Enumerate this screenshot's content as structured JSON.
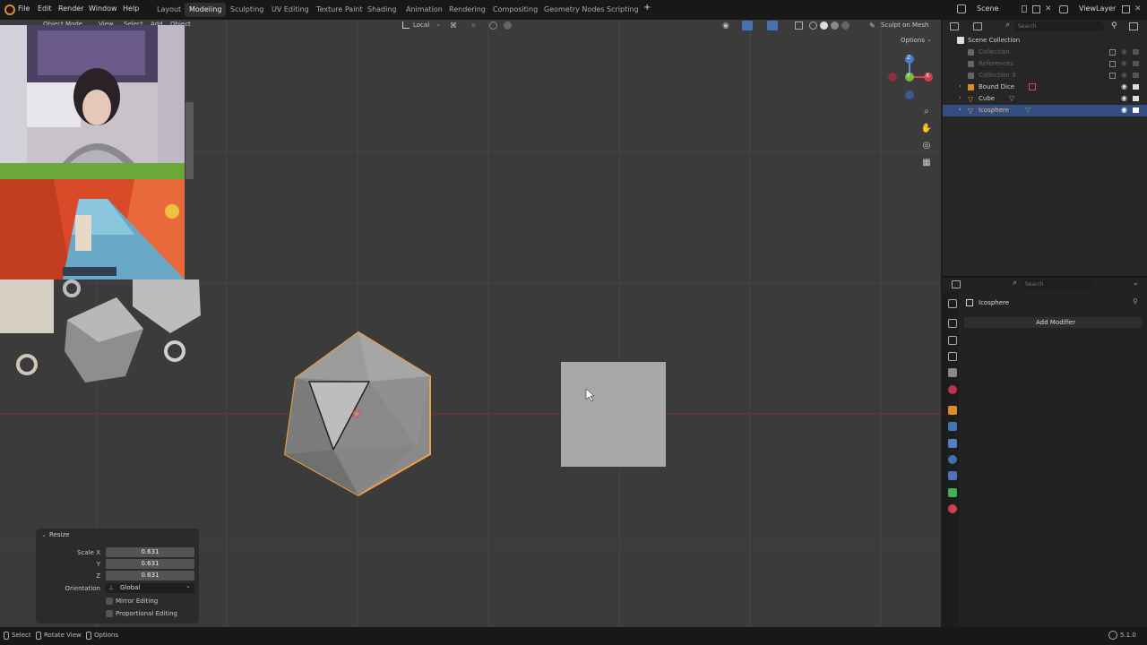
{
  "topbar": {
    "menus": [
      "File",
      "Edit",
      "Render",
      "Window",
      "Help"
    ],
    "workspaces": [
      "Layout",
      "Modeling",
      "Sculpting",
      "UV Editing",
      "Texture Paint",
      "Shading",
      "Animation",
      "Rendering",
      "Compositing",
      "Geometry Nodes",
      "Scripting"
    ],
    "active_workspace": "Modeling",
    "add_tab": "+",
    "scene": "Scene",
    "view_layer": "ViewLayer"
  },
  "viewport": {
    "header": {
      "mode": "Object Mode",
      "menus": [
        "View",
        "Select",
        "Add",
        "Object"
      ],
      "transform_orientation": "Local",
      "sculpt_button": "Sculpt on Mesh",
      "options": "Options"
    },
    "gizmo": {
      "z": "Z",
      "y": "Y",
      "x": "X"
    }
  },
  "resize_panel": {
    "title": "Resize",
    "scale_x_label": "Scale X",
    "scale_x": "0.631",
    "y_label": "Y",
    "scale_y": "0.631",
    "z_label": "Z",
    "scale_z": "0.631",
    "orientation_label": "Orientation",
    "orientation_value": "Global",
    "mirror_editing": "Mirror Editing",
    "proportional_editing": "Proportional Editing"
  },
  "outliner": {
    "search_placeholder": "Search",
    "root": "Scene Collection",
    "items": [
      {
        "label": "Collection",
        "dim": true
      },
      {
        "label": "References",
        "dim": true
      },
      {
        "label": "Collection 3",
        "dim": true
      },
      {
        "label": "Bound Dice",
        "dim": false
      },
      {
        "label": "Cube",
        "dim": false
      },
      {
        "label": "Icosphere",
        "dim": false,
        "selected": true
      }
    ]
  },
  "properties": {
    "search_placeholder": "Search",
    "object_name": "Icosphere",
    "add_modifier": "Add Modifier"
  },
  "statusbar": {
    "select": "Select",
    "rotate_view": "Rotate View",
    "options": "Options",
    "version": "5.1.0"
  },
  "colors": {
    "selection_outline": "#f0a040",
    "x_axis": "#c04050",
    "outliner_selected": "#334d80",
    "accent": "#4772b3"
  }
}
